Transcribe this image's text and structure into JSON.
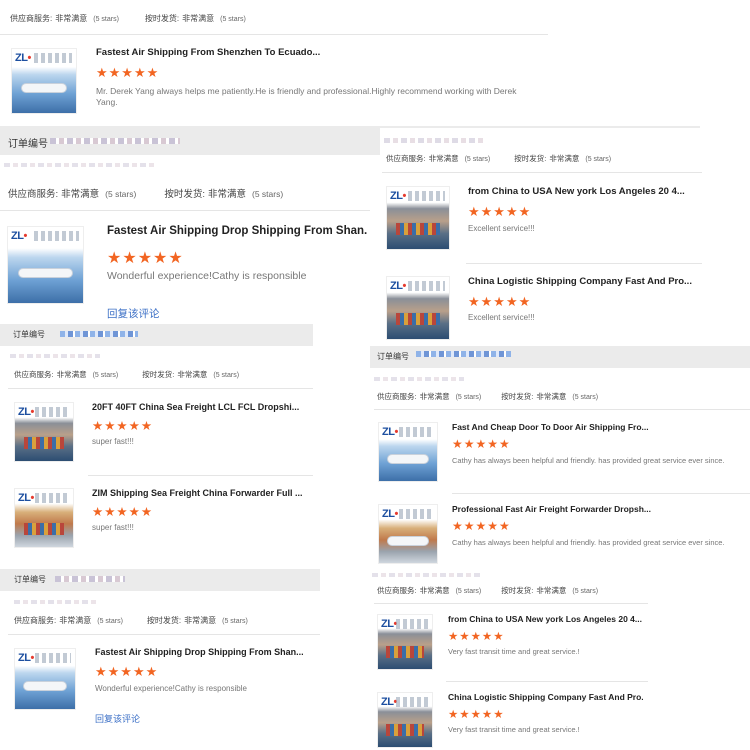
{
  "labels": {
    "supplier_service": "供应商服务:",
    "on_time_delivery": "按时发货:",
    "very_satisfied": "非常满意",
    "five_stars": "(5 stars)",
    "order_number": "订单编号",
    "reply": "回复该评论",
    "stars": "★★★★★"
  },
  "brand": {
    "logo": "ZL"
  },
  "colors": {
    "star": "#f26522",
    "link": "#3b6fc6",
    "strip": "#ebebeb"
  },
  "reviews": [
    {
      "title": "Fastest Air Shipping From Shenzhen To Ecuado...",
      "comment": "Mr. Derek Yang always helps me patiently.He is friendly and professional.Highly recommend working with Derek Yang."
    },
    {
      "title": "Fastest Air Shipping Drop Shipping From Shan...",
      "comment": "Wonderful experience!Cathy is responsible"
    },
    {
      "title": "20FT 40FT China Sea Freight LCL FCL Dropshi...",
      "comment": "super fast!!!"
    },
    {
      "title": "ZIM Shipping Sea Freight China Forwarder Full ...",
      "comment": "super fast!!!"
    },
    {
      "title": "Fastest Air Shipping Drop Shipping From Shan...",
      "comment": "Wonderful experience!Cathy is responsible"
    },
    {
      "title": "from China to USA New york Los Angeles 20 4...",
      "comment": "Excellent service!!!"
    },
    {
      "title": "China Logistic Shipping Company Fast And Pro...",
      "comment": "Excellent service!!!"
    },
    {
      "title": "Fast And Cheap Door To Door Air Shipping Fro...",
      "comment": "Cathy has always been helpful and friendly. has provided great service ever since."
    },
    {
      "title": "Professional Fast Air Freight Forwarder Dropsh...",
      "comment": "Cathy has always been helpful and friendly. has provided great service ever since."
    },
    {
      "title": "from China to USA New york Los Angeles 20 4...",
      "comment": "Very fast transit time and great service.!"
    },
    {
      "title": "China Logistic Shipping Company Fast And Pro...",
      "comment": "Very fast transit time and great service.!"
    }
  ]
}
